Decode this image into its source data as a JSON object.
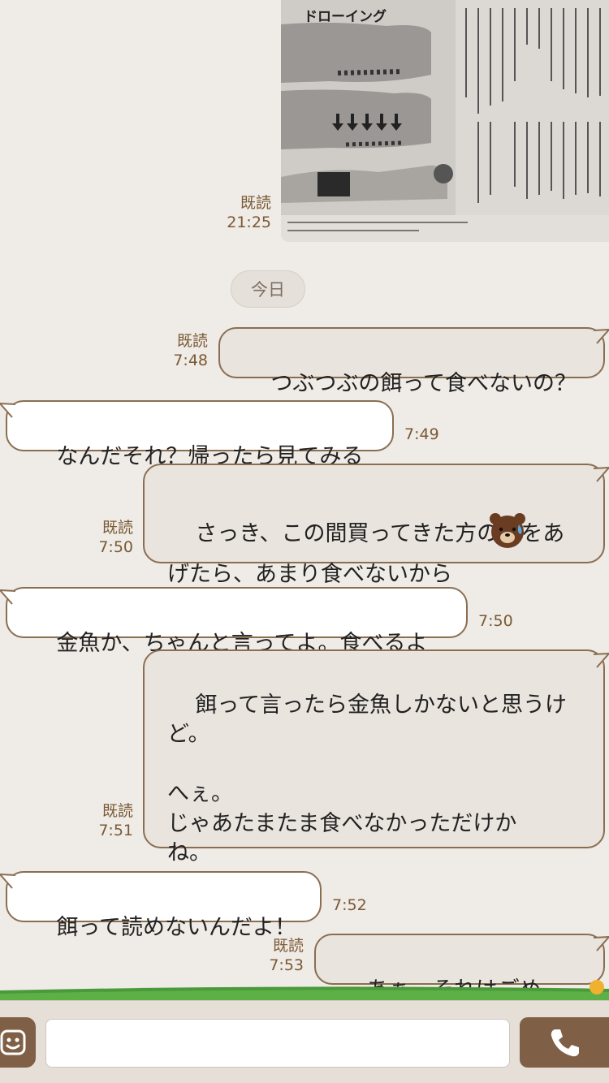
{
  "photo_message": {
    "read_label": "既読",
    "time": "21:25",
    "caption_heading": "ドローイング"
  },
  "date_separator": "今日",
  "messages": [
    {
      "side": "out",
      "text": "つぶつぶの餌って食べないの？",
      "read_label": "既読",
      "time": "7:48"
    },
    {
      "side": "in",
      "text": "なんだそれ？帰ったら見てみる",
      "time": "7:49"
    },
    {
      "side": "out",
      "text": "さっき、この間買ってきた方の餌をあ\nげたら、あまり食べないから",
      "read_label": "既読",
      "time": "7:50",
      "sticker_icon": "brown-bear-sweat-emoji"
    },
    {
      "side": "in",
      "text": "金魚か、ちゃんと言ってよ。食べるよ",
      "time": "7:50"
    },
    {
      "side": "out",
      "text": "餌って言ったら金魚しかないと思うけ\nど。\n\nへぇ。\nじゃあたまたま食べなかっただけか\nね。",
      "read_label": "既読",
      "time": "7:51"
    },
    {
      "side": "in",
      "text": "餌って読めないんだよ！",
      "time": "7:52"
    },
    {
      "side": "out",
      "text": "あぁ。それはごめん。",
      "read_label": "既読",
      "time": "7:53"
    }
  ],
  "input_bar": {
    "sticker_button_icon": "smiley-icon",
    "message_value": "",
    "call_button_icon": "phone-icon"
  },
  "colors": {
    "background": "#efebe6",
    "outgoing_bubble": "#eae4de",
    "incoming_bubble": "#ffffff",
    "bubble_border": "#8a6e52",
    "meta_text": "#7a5a34",
    "accent_brown": "#7f6046"
  }
}
